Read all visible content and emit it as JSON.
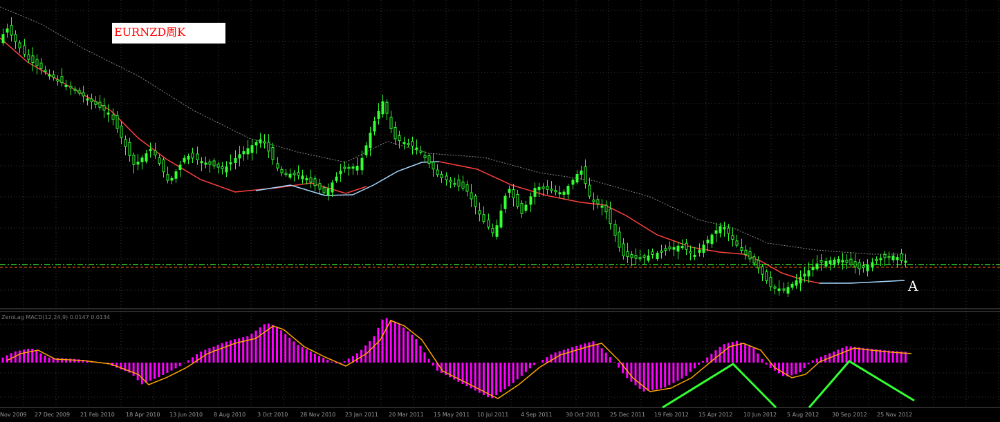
{
  "title": "EURNZD周K",
  "point_label": "A",
  "indicator_label": "ZeroLag MACD(12,24,9) 0.0147 0.0134",
  "colors": {
    "background": "#000000",
    "grid": "#3a3a3a",
    "bull_candle": "#33ff33",
    "bear_candle": "#000000",
    "candle_outline": "#33ff33",
    "ma_red": "#ff4040",
    "ma_lightblue": "#a8d8ff",
    "envelope": "#8a8a8a",
    "level_line": "#33ff33",
    "level_line_2": "#ff6a00",
    "macd_hist": "#ff00ff",
    "macd_signal": "#ffa500",
    "annotation": "#33ff33"
  },
  "chart_data": [
    {
      "type": "candlestick",
      "symbol": "EURNZD",
      "timeframe": "weekly",
      "x_tick_labels": [
        "Nov 2009",
        "27 Dec 2009",
        "21 Feb 2010",
        "18 Apr 2010",
        "13 Jun 2010",
        "8 Aug 2010",
        "3 Oct 2010",
        "28 Nov 2010",
        "23 Jan 2011",
        "20 Mar 2011",
        "15 May 2011",
        "10 Jul 2011",
        "4 Sep 2011",
        "30 Oct 2011",
        "25 Dec 2011",
        "19 Feb 2012",
        "15 Apr 2012",
        "10 Jun 2012",
        "5 Aug 2012",
        "30 Sep 2012",
        "25 Nov 2012"
      ],
      "horizontal_levels": [
        {
          "style": "dash-dot",
          "color": "green"
        },
        {
          "style": "dashed",
          "color": "orange"
        }
      ],
      "grid": true
    },
    {
      "type": "histogram+line",
      "indicator": "ZeroLag MACD",
      "grid": true
    }
  ]
}
